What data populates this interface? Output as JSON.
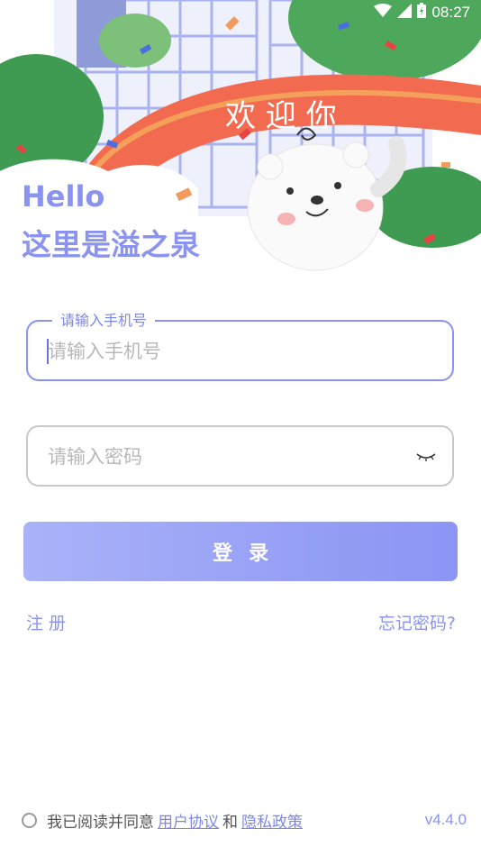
{
  "status_bar": {
    "time": "08:27",
    "icons": [
      "wifi-icon",
      "signal-icon",
      "battery-icon"
    ]
  },
  "banner": {
    "text": "欢 迎 你"
  },
  "greeting": {
    "hello": "Hello",
    "subtitle": "这里是溢之泉"
  },
  "form": {
    "phone_legend": "请输入手机号",
    "phone_placeholder": "请输入手机号",
    "password_placeholder": "请输入密码",
    "login_label": "登录"
  },
  "links": {
    "register": "注册",
    "forgot": "忘记密码?"
  },
  "agreement": {
    "prefix": "我已阅读并同意",
    "user_agreement": "用户协议",
    "and": "和",
    "privacy_policy": "隐私政策"
  },
  "version": "v4.4.0",
  "colors": {
    "accent": "#8a93ef",
    "button_start": "#aab2f8",
    "button_end": "#8b95f4",
    "banner": "#f26a4f"
  }
}
